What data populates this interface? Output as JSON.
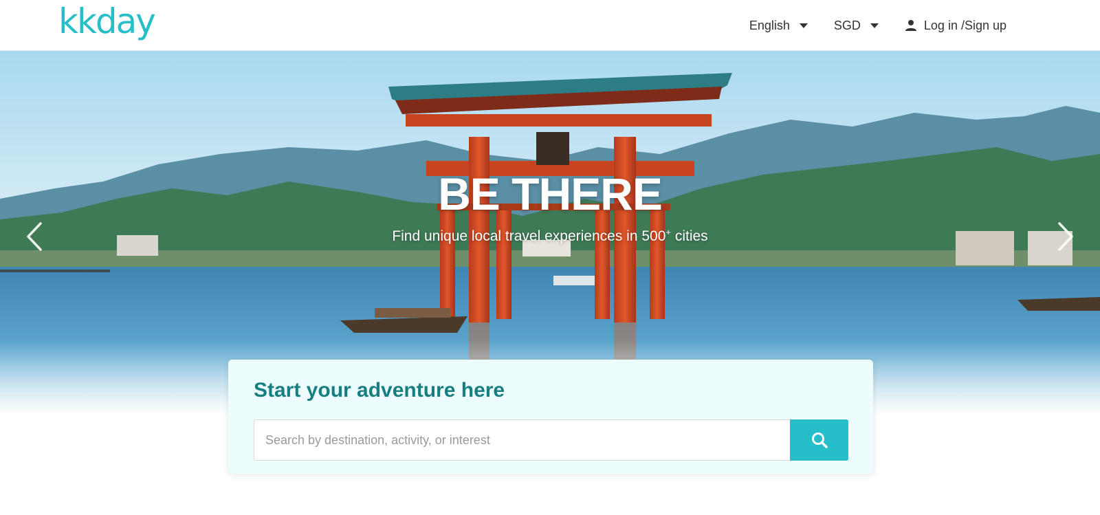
{
  "brand": {
    "logo_text": "kkday",
    "accent_color": "#26bec9",
    "heading_color": "#187f80"
  },
  "header": {
    "language": "English",
    "currency": "SGD",
    "login_label": "Log in /Sign up",
    "icons": {
      "language_caret": "caret-down-icon",
      "currency_caret": "caret-down-icon",
      "user": "user-icon"
    }
  },
  "hero": {
    "title": "BE THERE",
    "subtitle_prefix": "Find unique local travel experiences in 500",
    "subtitle_sup": "+",
    "subtitle_suffix": " cities",
    "icons": {
      "prev": "chevron-left-icon",
      "next": "chevron-right-icon"
    }
  },
  "search": {
    "heading": "Start your adventure here",
    "placeholder": "Search by destination, activity, or interest",
    "value": "",
    "button_icon": "search-icon"
  }
}
